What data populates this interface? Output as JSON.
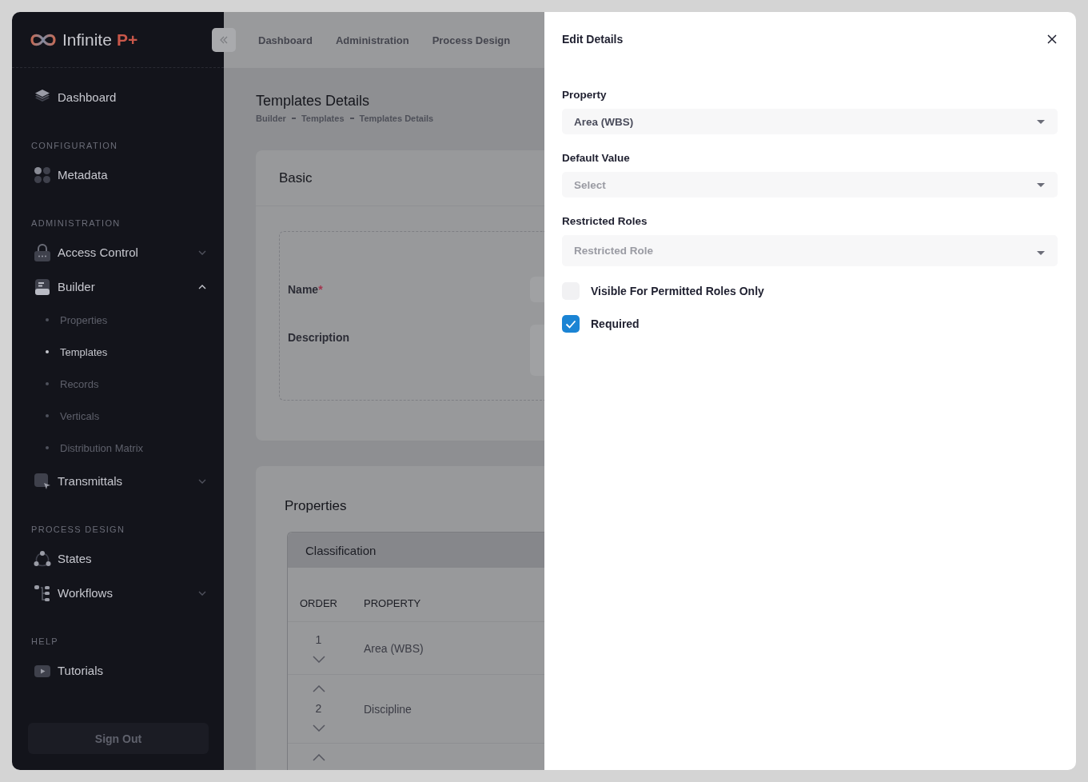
{
  "brand": {
    "name": "Infinite",
    "suffix": "P+"
  },
  "sidebar": {
    "groups": [
      {
        "items": [
          {
            "label": "Dashboard"
          }
        ]
      },
      {
        "heading": "CONFIGURATION",
        "items": [
          {
            "label": "Metadata"
          }
        ]
      },
      {
        "heading": "ADMINISTRATION",
        "items": [
          {
            "label": "Access Control",
            "expanded": false
          },
          {
            "label": "Builder",
            "expanded": true,
            "children": [
              {
                "label": "Properties",
                "selected": false
              },
              {
                "label": "Templates",
                "selected": true
              },
              {
                "label": "Records",
                "selected": false
              },
              {
                "label": "Verticals",
                "selected": false
              },
              {
                "label": "Distribution Matrix",
                "selected": false
              }
            ]
          },
          {
            "label": "Transmittals",
            "expanded": false
          }
        ]
      },
      {
        "heading": "PROCESS DESIGN",
        "items": [
          {
            "label": "States"
          },
          {
            "label": "Workflows",
            "expanded": false
          }
        ]
      },
      {
        "heading": "HELP",
        "items": [
          {
            "label": "Tutorials"
          }
        ]
      }
    ],
    "sign_out": "Sign Out"
  },
  "top_nav": [
    "Dashboard",
    "Administration",
    "Process Design"
  ],
  "page": {
    "title": "Templates Details",
    "breadcrumb": [
      "Builder",
      "Templates",
      "Templates Details"
    ]
  },
  "basic_card": {
    "title": "Basic",
    "fields": [
      {
        "label": "Name",
        "required_mark": "*"
      },
      {
        "label": "Description",
        "multiline": true
      }
    ]
  },
  "properties_card": {
    "title": "Properties",
    "group": {
      "title": "Classification",
      "columns": [
        "ORDER",
        "PROPERTY"
      ],
      "rows": [
        {
          "order": "1",
          "property": "Area (WBS)",
          "can_move_up": false,
          "can_move_down": true
        },
        {
          "order": "2",
          "property": "Discipline",
          "can_move_up": true,
          "can_move_down": true
        },
        {
          "can_move_up": true
        }
      ]
    }
  },
  "drawer": {
    "title": "Edit Details",
    "fields": [
      {
        "label": "Property",
        "value": "Area (WBS)",
        "multiple": false
      },
      {
        "label": "Default Value",
        "placeholder": "Select",
        "multiple": false
      },
      {
        "label": "Restricted Roles",
        "placeholder": "Restricted Role",
        "multiple": true
      }
    ],
    "checkboxes": [
      {
        "label": "Visible For Permitted Roles Only",
        "checked": false
      },
      {
        "label": "Required",
        "checked": true
      }
    ]
  }
}
